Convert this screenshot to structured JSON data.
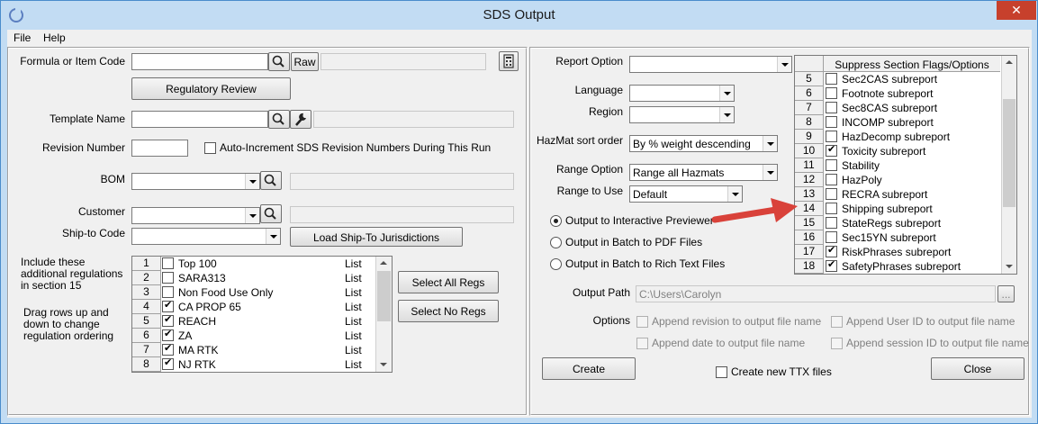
{
  "window": {
    "title": "SDS Output",
    "close": "✕"
  },
  "menu": [
    "File",
    "Help"
  ],
  "left": {
    "formula_label": "Formula or Item Code",
    "formula_value": "",
    "raw_button": "Raw",
    "regulatory_review_button": "Regulatory Review",
    "template_label": "Template Name",
    "revision_label": "Revision Number",
    "auto_increment_label": "Auto-Increment SDS Revision Numbers During This Run",
    "bom_label": "BOM",
    "customer_label": "Customer",
    "shipto_label": "Ship-to Code",
    "load_shipto_button": "Load Ship-To Jurisdictions",
    "include_regs_label": "Include these additional regulations in section 15",
    "drag_rows_label": "Drag rows up and down to change regulation ordering",
    "select_all_regs": "Select All Regs",
    "select_no_regs": "Select No Regs",
    "regs": [
      {
        "num": "1",
        "checked": false,
        "name": "Top 100",
        "type": "List"
      },
      {
        "num": "2",
        "checked": false,
        "name": "SARA313",
        "type": "List"
      },
      {
        "num": "3",
        "checked": false,
        "name": "Non Food Use Only",
        "type": "List"
      },
      {
        "num": "4",
        "checked": true,
        "name": "CA PROP 65",
        "type": "List"
      },
      {
        "num": "5",
        "checked": true,
        "name": "REACH",
        "type": "List"
      },
      {
        "num": "6",
        "checked": true,
        "name": "ZA",
        "type": "List"
      },
      {
        "num": "7",
        "checked": true,
        "name": "MA RTK",
        "type": "List"
      },
      {
        "num": "8",
        "checked": true,
        "name": "NJ RTK",
        "type": "List"
      }
    ]
  },
  "right": {
    "report_option_label": "Report Option",
    "report_option_value": "",
    "language_label": "Language",
    "region_label": "Region",
    "hazmat_sort_label": "HazMat sort order",
    "hazmat_sort_value": "By % weight descending",
    "range_option_label": "Range Option",
    "range_option_value": "Range all Hazmats",
    "range_to_use_label": "Range to Use",
    "range_to_use_value": "Default",
    "output_options": [
      {
        "label": "Output to Interactive Previewer",
        "selected": true
      },
      {
        "label": "Output in Batch to PDF Files",
        "selected": false
      },
      {
        "label": "Output in Batch to Rich Text Files",
        "selected": false
      }
    ],
    "output_path_label": "Output Path",
    "output_path_value": "C:\\Users\\Carolyn",
    "browse_label": "...",
    "options_label": "Options",
    "opt_append_revision": "Append revision to output file name",
    "opt_append_user": "Append User ID to output file name",
    "opt_append_date": "Append date to output file name",
    "opt_append_session": "Append session ID to output file name",
    "create_button": "Create",
    "create_ttx_label": "Create new TTX files",
    "close_button": "Close",
    "suppress_header": "Suppress Section Flags/Options",
    "suppress": [
      {
        "num": "5",
        "checked": false,
        "name": "Sec2CAS subreport"
      },
      {
        "num": "6",
        "checked": false,
        "name": "Footnote subreport"
      },
      {
        "num": "7",
        "checked": false,
        "name": "Sec8CAS subreport"
      },
      {
        "num": "8",
        "checked": false,
        "name": "INCOMP subreport"
      },
      {
        "num": "9",
        "checked": false,
        "name": "HazDecomp subreport"
      },
      {
        "num": "10",
        "checked": true,
        "name": "Toxicity subreport"
      },
      {
        "num": "11",
        "checked": false,
        "name": "Stability"
      },
      {
        "num": "12",
        "checked": false,
        "name": "HazPoly"
      },
      {
        "num": "13",
        "checked": false,
        "name": "RECRA subreport"
      },
      {
        "num": "14",
        "checked": false,
        "name": "Shipping subreport"
      },
      {
        "num": "15",
        "checked": false,
        "name": "StateRegs subreport"
      },
      {
        "num": "16",
        "checked": false,
        "name": "Sec15YN subreport"
      },
      {
        "num": "17",
        "checked": true,
        "name": "RiskPhrases subreport"
      },
      {
        "num": "18",
        "checked": true,
        "name": "SafetyPhrases subreport"
      }
    ]
  },
  "colors": {
    "arrow": "#d9423a",
    "title_bg": "#c2dcf3",
    "close_bg": "#c7402c"
  }
}
